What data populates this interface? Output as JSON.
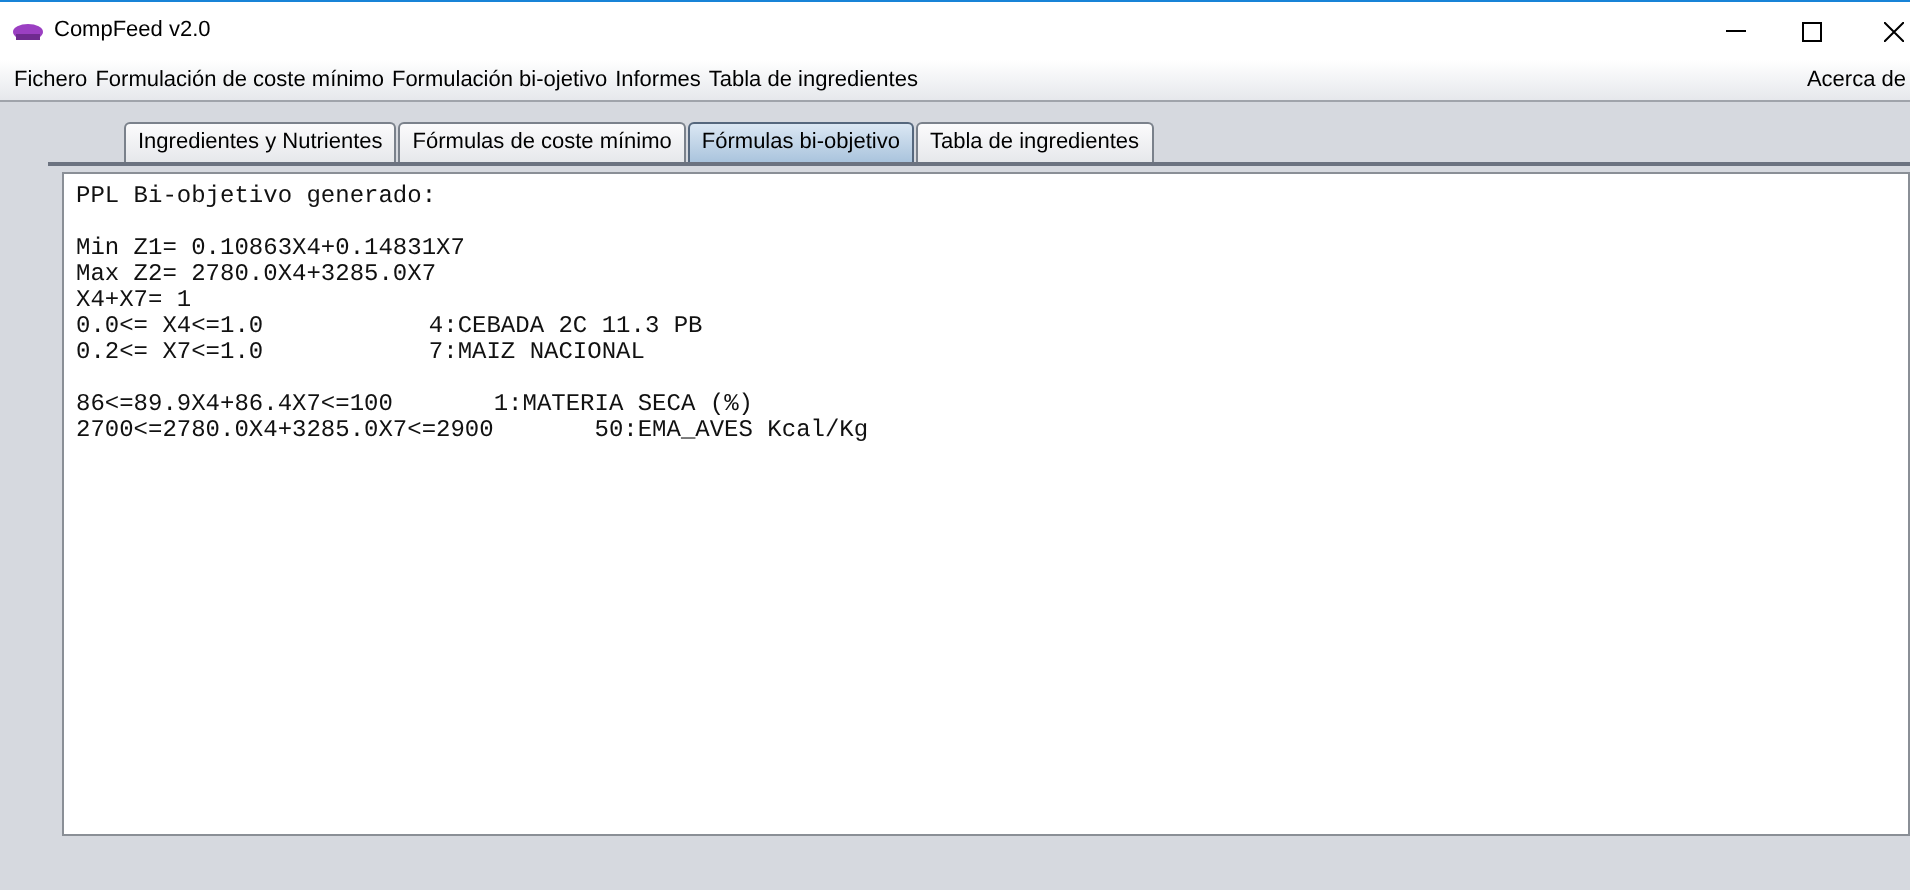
{
  "window": {
    "title": "CompFeed v2.0"
  },
  "menu": [
    "Fichero",
    "Formulación de coste mínimo",
    "Formulación bi-ojetivo",
    "Informes",
    "Tabla de ingredientes"
  ],
  "menu_right": "Acerca de",
  "tabs": [
    {
      "label": "Ingredientes y Nutrientes",
      "selected": false
    },
    {
      "label": "Fórmulas de coste mínimo",
      "selected": false
    },
    {
      "label": "Fórmulas bi-objetivo",
      "selected": true
    },
    {
      "label": "Tabla de ingredientes",
      "selected": false
    }
  ],
  "output": [
    {
      "kind": "text",
      "text": "PPL Bi-objetivo generado:"
    },
    {
      "kind": "blank"
    },
    {
      "kind": "text",
      "text": "Min Z1= 0.10863X4+0.14831X7"
    },
    {
      "kind": "text",
      "text": "Max Z2= 2780.0X4+3285.0X7"
    },
    {
      "kind": "text",
      "text": "X4+X7= 1"
    },
    {
      "kind": "bound",
      "text": "0.0<= X4<=1.0",
      "note": "4:CEBADA 2C 11.3 PB"
    },
    {
      "kind": "bound",
      "text": "0.2<= X7<=1.0",
      "note": "7:MAIZ NACIONAL"
    },
    {
      "kind": "blank"
    },
    {
      "kind": "constraint",
      "text": "86<=89.9X4+86.4X7<=100",
      "note": "1:MATERIA SECA (%)"
    },
    {
      "kind": "constraint",
      "text": "2700<=2780.0X4+3285.0X7<=2900",
      "note": "50:EMA_AVES Kcal/Kg"
    }
  ]
}
